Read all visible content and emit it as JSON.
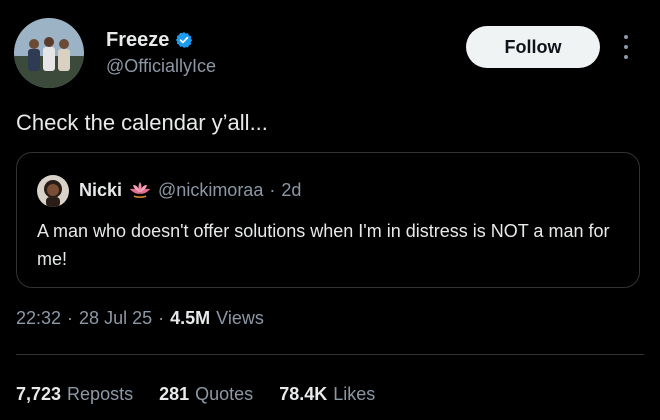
{
  "author": {
    "display_name": "Freeze",
    "handle": "@OfficiallyIce",
    "verified": true,
    "avatar_icon": "group-photo-avatar"
  },
  "actions": {
    "follow_label": "Follow",
    "more_icon": "more-vertical-icon"
  },
  "tweet": {
    "text": "Check the calendar y’all..."
  },
  "quote": {
    "display_name": "Nicki",
    "badge_icon": "lotus-icon",
    "handle": "@nickimoraa",
    "separator": "·",
    "time": "2d",
    "text": "A man who doesn't offer solutions when I'm in distress is NOT a man for me!"
  },
  "meta": {
    "time": "22:32",
    "date": "28 Jul 25",
    "views_count": "4.5M",
    "views_label": "Views",
    "separator": "·"
  },
  "stats": [
    {
      "value": "7,723",
      "label": "Reposts"
    },
    {
      "value": "281",
      "label": "Quotes"
    },
    {
      "value": "78.4K",
      "label": "Likes"
    }
  ],
  "colors": {
    "background": "#000000",
    "text": "#e7e9ea",
    "muted": "#8b98a5",
    "verified_blue": "#1d9bf0",
    "border": "#2f3336"
  }
}
